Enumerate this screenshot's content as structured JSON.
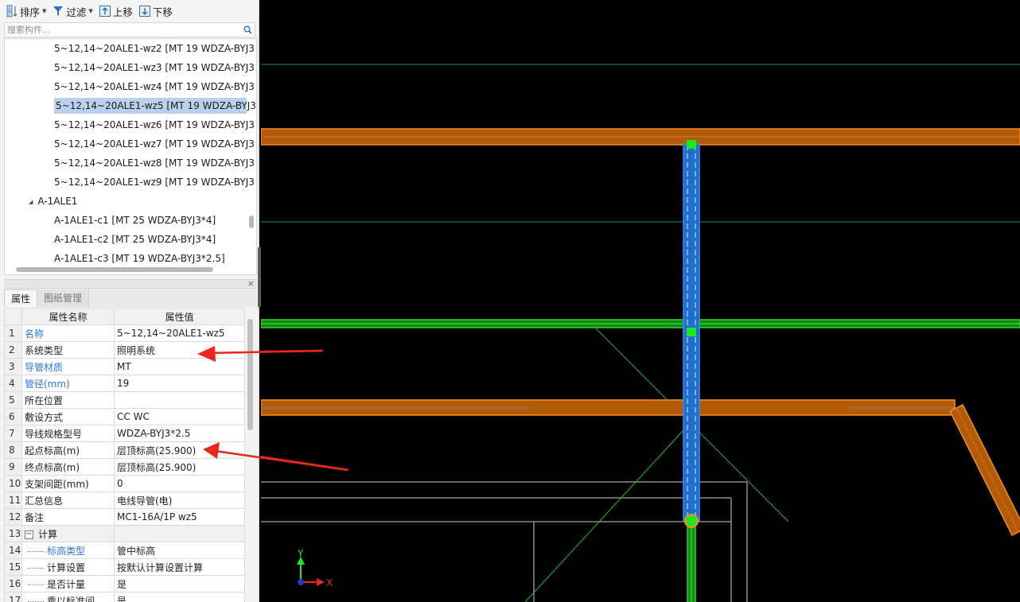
{
  "toolbar": {
    "sort_label": "排序",
    "filter_label": "过滤",
    "move_up_label": "上移",
    "move_down_label": "下移"
  },
  "search": {
    "placeholder": "搜索构件..."
  },
  "tree": {
    "items": [
      {
        "label": "5~12,14~20ALE1-wz2 [MT 19 WDZA-BYJ3",
        "selected": false
      },
      {
        "label": "5~12,14~20ALE1-wz3 [MT 19 WDZA-BYJ3",
        "selected": false
      },
      {
        "label": "5~12,14~20ALE1-wz4 [MT 19 WDZA-BYJ3",
        "selected": false
      },
      {
        "label": "5~12,14~20ALE1-wz5 [MT 19 WDZA-BYJ3",
        "selected": true
      },
      {
        "label": "5~12,14~20ALE1-wz6 [MT 19 WDZA-BYJ3",
        "selected": false
      },
      {
        "label": "5~12,14~20ALE1-wz7 [MT 19 WDZA-BYJ3",
        "selected": false
      },
      {
        "label": "5~12,14~20ALE1-wz8 [MT 19 WDZA-BYJ3",
        "selected": false
      },
      {
        "label": "5~12,14~20ALE1-wz9 [MT 19 WDZA-BYJ3",
        "selected": false
      }
    ],
    "group_label": "A-1ALE1",
    "group_items": [
      {
        "label": "A-1ALE1-c1 [MT 25 WDZA-BYJ3*4]"
      },
      {
        "label": "A-1ALE1-c2 [MT 25 WDZA-BYJ3*4]"
      },
      {
        "label": "A-1ALE1-c3 [MT 19 WDZA-BYJ3*2.5]"
      }
    ]
  },
  "tabs": {
    "properties": "属性",
    "drawing_mgmt": "图纸管理"
  },
  "props": {
    "col_name": "属性名称",
    "col_value": "属性值",
    "rows": [
      {
        "num": "1",
        "name": "名称",
        "value": "5~12,14~20ALE1-wz5",
        "blue": true
      },
      {
        "num": "2",
        "name": "系统类型",
        "value": "照明系统",
        "blue": false
      },
      {
        "num": "3",
        "name": "导管材质",
        "value": "MT",
        "blue": true
      },
      {
        "num": "4",
        "name": "管径(mm)",
        "value": "19",
        "blue": true
      },
      {
        "num": "5",
        "name": "所在位置",
        "value": "",
        "blue": false
      },
      {
        "num": "6",
        "name": "敷设方式",
        "value": "CC WC",
        "blue": false
      },
      {
        "num": "7",
        "name": "导线规格型号",
        "value": "WDZA-BYJ3*2.5",
        "blue": false
      },
      {
        "num": "8",
        "name": "起点标高(m)",
        "value": "层顶标高(25.900)",
        "blue": false
      },
      {
        "num": "9",
        "name": "终点标高(m)",
        "value": "层顶标高(25.900)",
        "blue": false
      },
      {
        "num": "10",
        "name": "支架间距(mm)",
        "value": "0",
        "blue": false
      },
      {
        "num": "11",
        "name": "汇总信息",
        "value": "电线导管(电)",
        "blue": false
      },
      {
        "num": "12",
        "name": "备注",
        "value": "MC1-16A/1P wz5",
        "blue": false
      }
    ],
    "section": {
      "num": "13",
      "box": "−",
      "name": "计算"
    },
    "sub_rows": [
      {
        "num": "14",
        "name": "标高类型",
        "value": "管中标高",
        "blue": true
      },
      {
        "num": "15",
        "name": "计算设置",
        "value": "按默认计算设置计算",
        "blue": false
      },
      {
        "num": "16",
        "name": "是否计量",
        "value": "是",
        "blue": false
      },
      {
        "num": "17",
        "name": "乘以标准间",
        "value": "是",
        "blue": false
      }
    ]
  },
  "axis": {
    "x_label": "X",
    "y_label": "Y"
  },
  "colors": {
    "orange_duct": "#c25e05",
    "orange_edge": "#ff8c1a",
    "blue_pipe": "#1e6fd0",
    "green_pipe": "#22c01e",
    "cyan_line": "#1d8a8a",
    "arrow_red": "#e8281c"
  }
}
